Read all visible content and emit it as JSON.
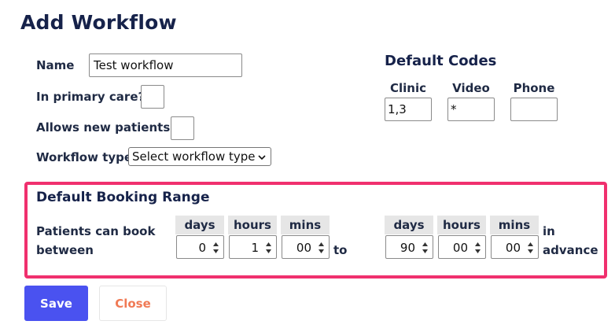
{
  "title": "Add Workflow",
  "form": {
    "name_label": "Name",
    "name_value": "Test workflow",
    "primary_care_label": "In primary care?",
    "new_patients_label": "Allows new patients?",
    "workflow_type_label": "Workflow type",
    "workflow_type_selected": "Select workflow type"
  },
  "default_codes": {
    "title": "Default Codes",
    "clinic_label": "Clinic",
    "clinic_value": "1,3",
    "video_label": "Video",
    "video_value": "*",
    "phone_label": "Phone",
    "phone_value": ""
  },
  "booking_range": {
    "title": "Default Booking Range",
    "desc_line1": "Patients can book",
    "desc_line2": "between",
    "to_label": "to",
    "in_label": "in",
    "advance_label": "advance",
    "start": {
      "days_label": "days",
      "days_value": "0",
      "hours_label": "hours",
      "hours_value": "1",
      "mins_label": "mins",
      "mins_value": "00"
    },
    "end": {
      "days_label": "days",
      "days_value": "90",
      "hours_label": "hours",
      "hours_value": "00",
      "mins_label": "mins",
      "mins_value": "00"
    }
  },
  "actions": {
    "save_label": "Save",
    "close_label": "Close"
  },
  "colors": {
    "accent": "#4a52f0",
    "highlight_border": "#f0306e",
    "close_text": "#f07a55"
  }
}
